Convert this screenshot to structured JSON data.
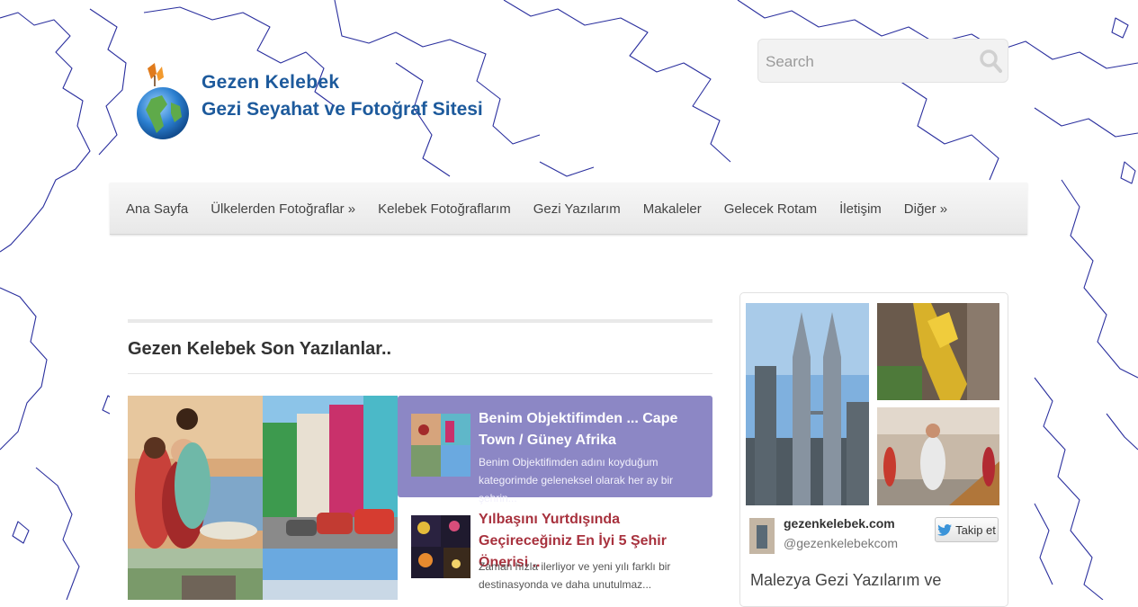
{
  "site": {
    "name": "Gezen Kelebek",
    "tagline": "Gezi Seyahat ve Fotoğraf Sitesi"
  },
  "search": {
    "placeholder": "Search",
    "icon": "search-icon"
  },
  "nav": {
    "items": [
      "Ana Sayfa",
      "Ülkelerden Fotoğraflar »",
      "Kelebek Fotoğraflarım",
      "Gezi Yazılarım",
      "Makaleler",
      "Gelecek Rotam",
      "İletişim",
      "Diğer »"
    ]
  },
  "main": {
    "section_title": "Gezen Kelebek Son Yazılanlar..",
    "slides": [
      {
        "title": "Benim Objektifimden ... Cape Town / Güney Afrika",
        "excerpt": "Benim Objektifimden adını koyduğum kategorimde geleneksel olarak her ay bir şehrin..."
      },
      {
        "title": "Yılbaşını Yurtdışında Geçireceğiniz En İyi 5 Şehir Önerisi ..",
        "excerpt": "Zaman hızla ilerliyor ve  yeni yılı farklı bir destinasyonda ve daha unutulmaz..."
      }
    ]
  },
  "sidebar": {
    "twitter": {
      "name": "gezenkelebek.com",
      "handle": "@gezenkelebekcom",
      "follow_label": "Takip et",
      "icon": "twitter-bird-icon"
    },
    "widget_text": "Malezya Gezi Yazılarım ve"
  },
  "colors": {
    "logo_text": "#1d5a9c",
    "slide_active_bg": "#8c87c5",
    "slide_title_red": "#a8323e",
    "map_lines": "#2a2f9e"
  }
}
